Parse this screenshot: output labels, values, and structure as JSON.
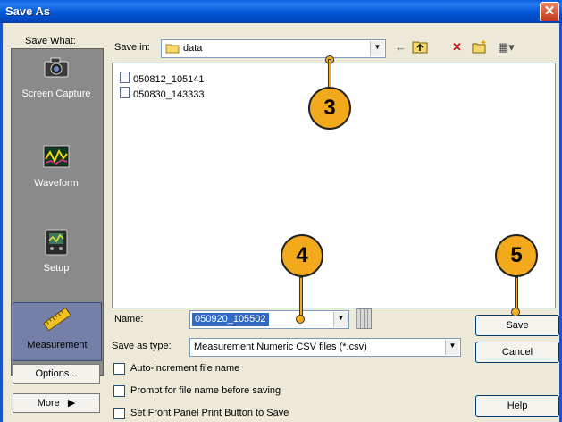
{
  "window": {
    "title": "Save As",
    "close_symbol": "✕"
  },
  "places": {
    "header": "Save What:",
    "items": [
      {
        "label": "Screen Capture",
        "icon": "camera-icon"
      },
      {
        "label": "Waveform",
        "icon": "waveform-icon"
      },
      {
        "label": "Setup",
        "icon": "setup-icon"
      },
      {
        "label": "Measurement",
        "icon": "ruler-icon",
        "selected": true
      }
    ],
    "options_label": "Options...",
    "more_label": "More",
    "more_arrow": "▶"
  },
  "save_in": {
    "label": "Save in:",
    "value": "data"
  },
  "toolbar": {
    "back": "←",
    "up": "⮤",
    "delete": "✕",
    "new_folder": "✱",
    "views": "▦▾"
  },
  "files": [
    "050812_105141",
    "050830_143333"
  ],
  "name": {
    "label": "Name:",
    "value": "050920_105502"
  },
  "save_as_type": {
    "label": "Save as type:",
    "value": "Measurement Numeric CSV files (*.csv)"
  },
  "checkboxes": [
    "Auto-increment file name",
    "Prompt for file name before saving",
    "Set Front Panel Print Button to Save"
  ],
  "buttons": {
    "save": "Save",
    "cancel": "Cancel",
    "help": "Help"
  },
  "callouts": [
    "3",
    "4",
    "5"
  ],
  "colors": {
    "title_bar": "#0058d8",
    "callout": "#f3a91c",
    "selection": "#316ac5"
  }
}
